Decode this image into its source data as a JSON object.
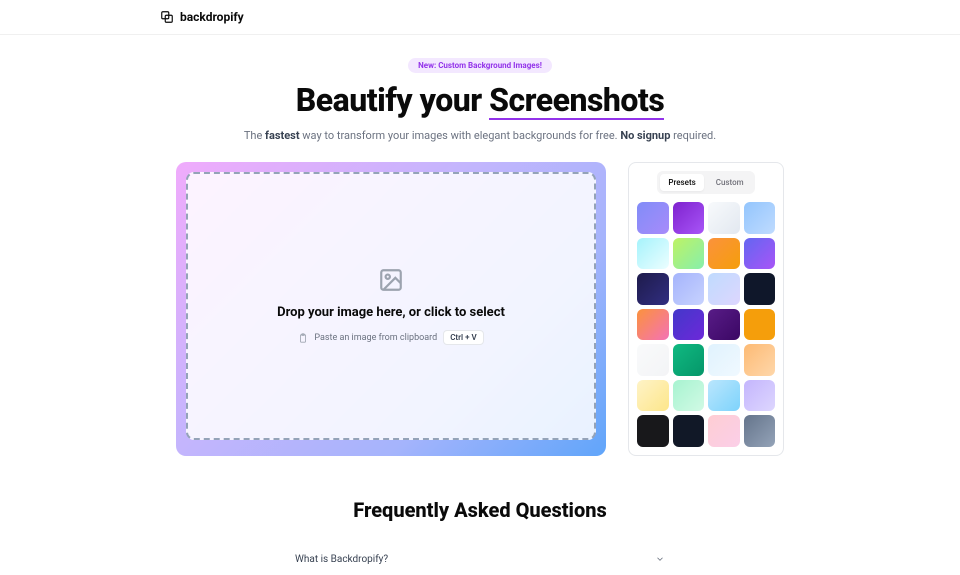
{
  "brand": "backdropify",
  "hero": {
    "pill": "New: Custom Background Images!",
    "title_pre": "Beautify your ",
    "title_underline": "Screenshots",
    "subtitle_pre": "The ",
    "subtitle_b1": "fastest",
    "subtitle_mid": " way to transform your images with elegant backgrounds for free. ",
    "subtitle_b2": "No signup",
    "subtitle_post": " required."
  },
  "dropzone": {
    "title": "Drop your image here, or click to select",
    "paste": "Paste an image from clipboard",
    "kbd": "Ctrl + V"
  },
  "tabs": {
    "presets": "Presets",
    "custom": "Custom"
  },
  "swatches": [
    "linear-gradient(135deg,#818cf8,#a78bfa)",
    "linear-gradient(135deg,#7e22ce,#a855f7)",
    "linear-gradient(135deg,#f8fafc,#e2e8f0)",
    "linear-gradient(135deg,#93c5fd,#bfdbfe)",
    "linear-gradient(135deg,#a5f3fc,#ecfeff)",
    "linear-gradient(135deg,#bef264,#86efac)",
    "linear-gradient(135deg,#fb923c,#f59e0b)",
    "linear-gradient(135deg,#6366f1,#a855f7)",
    "linear-gradient(135deg,#1e1b4b,#312e81)",
    "linear-gradient(135deg,#a5b4fc,#c7d2fe)",
    "linear-gradient(135deg,#bfdbfe,#ddd6fe)",
    "#0f172a",
    "linear-gradient(135deg,#fb923c,#f472b6)",
    "linear-gradient(135deg,#4338ca,#6d28d9)",
    "linear-gradient(135deg,#581c87,#3b0764)",
    "#f59e0b",
    "linear-gradient(135deg,#f9fafb,#f3f4f6)",
    "linear-gradient(135deg,#10b981,#059669)",
    "linear-gradient(135deg,#e0f2fe,#f0f9ff)",
    "linear-gradient(135deg,#fdba74,#fed7aa)",
    "linear-gradient(135deg,#fef3c7,#fde68a)",
    "linear-gradient(135deg,#a7f3d0,#d1fae5)",
    "linear-gradient(135deg,#bae6fd,#7dd3fc)",
    "linear-gradient(135deg,#c4b5fd,#ddd6fe)",
    "#18181b",
    "#111827",
    "linear-gradient(135deg,#fecdd3,#fbcfe8)",
    "linear-gradient(135deg,#64748b,#94a3b8)"
  ],
  "faq": {
    "title": "Frequently Asked Questions",
    "q1": "What is Backdropify?"
  }
}
